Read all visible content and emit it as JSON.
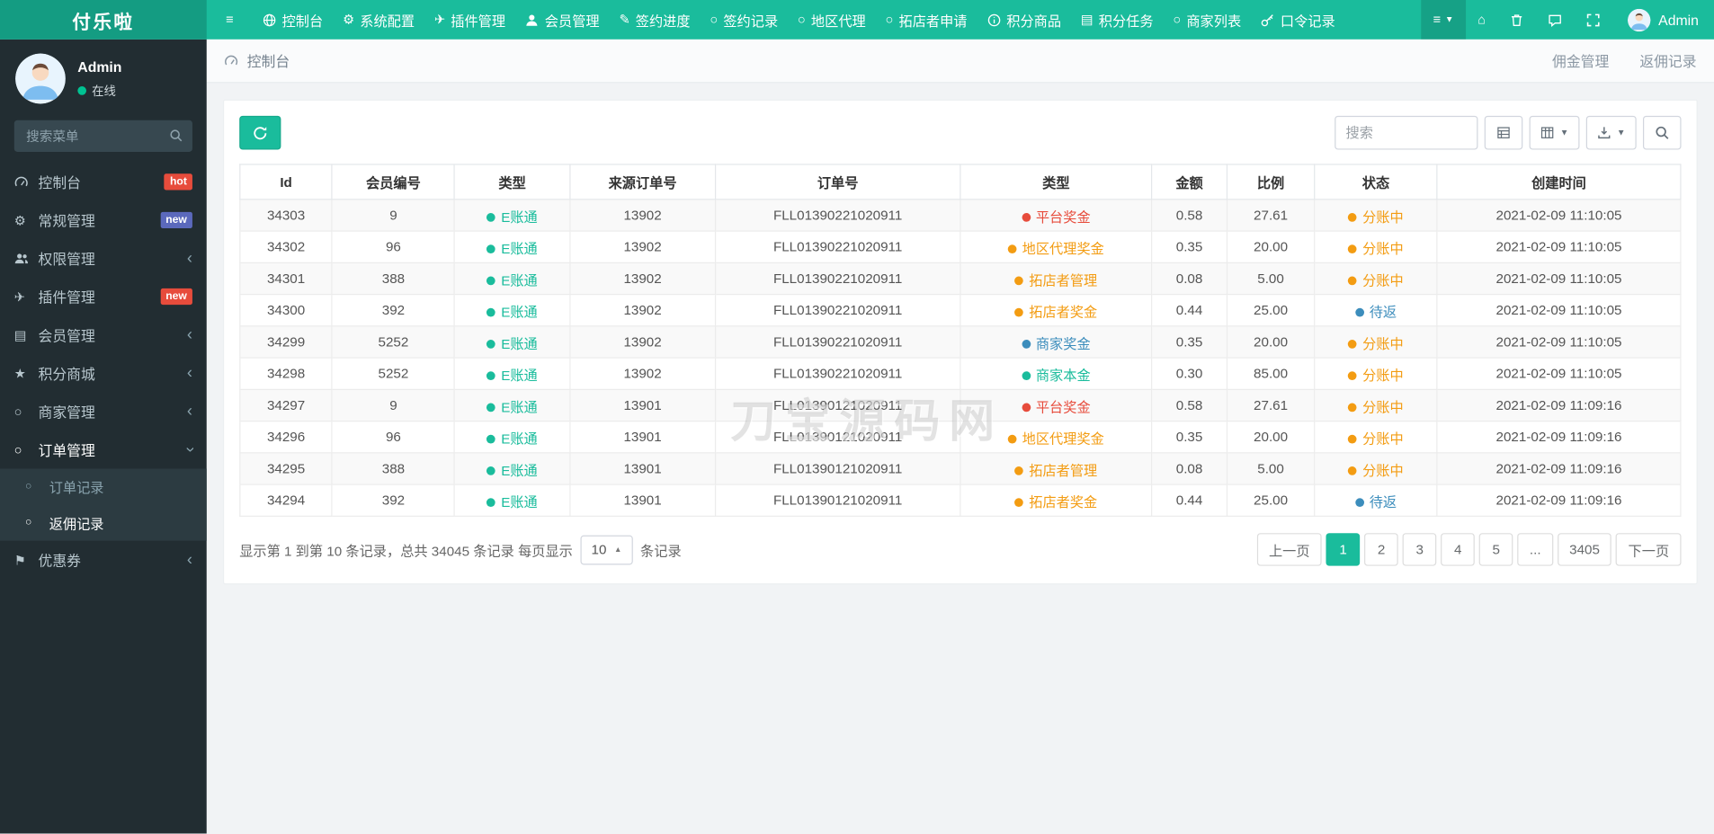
{
  "brand": "付乐啦",
  "colors": {
    "accent": "#1abc9c",
    "red": "#e74c3c",
    "orange": "#f39c12",
    "blue": "#3c8dbc",
    "green": "#1abc9c"
  },
  "topnav": {
    "username": "Admin",
    "items": [
      {
        "key": "console",
        "icon": "globe",
        "label": "控制台"
      },
      {
        "key": "system-config",
        "icon": "gear",
        "label": "系统配置"
      },
      {
        "key": "addon-manage",
        "icon": "plane",
        "label": "插件管理"
      },
      {
        "key": "member-manage",
        "icon": "user",
        "label": "会员管理"
      },
      {
        "key": "sign-progress",
        "icon": "pencil",
        "label": "签约进度"
      },
      {
        "key": "sign-records",
        "icon": "circle",
        "label": "签约记录"
      },
      {
        "key": "region-agent",
        "icon": "circle",
        "label": "地区代理"
      },
      {
        "key": "shop-applicant",
        "icon": "circle",
        "label": "拓店者申请"
      },
      {
        "key": "score-goods",
        "icon": "info",
        "label": "积分商品"
      },
      {
        "key": "score-tasks",
        "icon": "list",
        "label": "积分任务"
      },
      {
        "key": "merchant-list",
        "icon": "circle",
        "label": "商家列表"
      },
      {
        "key": "token-records",
        "icon": "key",
        "label": "口令记录"
      }
    ]
  },
  "sidebar": {
    "username": "Admin",
    "status": "在线",
    "search_placeholder": "搜索菜单",
    "items": [
      {
        "key": "dashboard",
        "icon": "gauge",
        "label": "控制台",
        "badge": "hot",
        "badge_color": "#e74c3c"
      },
      {
        "key": "general-manage",
        "icon": "gear",
        "label": "常规管理",
        "badge": "new",
        "badge_color": "#5b69bc"
      },
      {
        "key": "auth-manage",
        "icon": "users",
        "label": "权限管理",
        "chevron": "left"
      },
      {
        "key": "addon-manage",
        "icon": "plane",
        "label": "插件管理",
        "badge": "new",
        "badge_color": "#e74c3c"
      },
      {
        "key": "member-manage",
        "icon": "list",
        "label": "会员管理",
        "chevron": "left"
      },
      {
        "key": "score-mall",
        "icon": "star",
        "label": "积分商城",
        "chevron": "left"
      },
      {
        "key": "merchant-manage",
        "icon": "circle",
        "label": "商家管理",
        "chevron": "left"
      },
      {
        "key": "order-manage",
        "icon": "circle",
        "label": "订单管理",
        "chevron": "down",
        "open": true,
        "children": [
          {
            "key": "order-records",
            "icon": "circle",
            "label": "订单记录",
            "active": false
          },
          {
            "key": "commission-records",
            "icon": "circle",
            "label": "返佣记录",
            "active": true
          }
        ]
      },
      {
        "key": "coupon",
        "icon": "flag",
        "label": "优惠券",
        "chevron": "left"
      }
    ]
  },
  "breadcrumb": {
    "left": "控制台",
    "right": [
      "佣金管理",
      "返佣记录"
    ]
  },
  "toolbar": {
    "search_placeholder": "搜索"
  },
  "table": {
    "columns": [
      "Id",
      "会员编号",
      "类型",
      "来源订单号",
      "订单号",
      "类型",
      "金额",
      "比例",
      "状态",
      "创建时间"
    ],
    "rows": [
      {
        "id": "34303",
        "member": "9",
        "account_type": "E账通",
        "source_order": "13902",
        "order_no": "FLL01390221020911",
        "bonus_type": "平台奖金",
        "bonus_color": "red",
        "amount": "0.58",
        "ratio": "27.61",
        "status": "分账中",
        "status_color": "orange",
        "created_at": "2021-02-09 11:10:05"
      },
      {
        "id": "34302",
        "member": "96",
        "account_type": "E账通",
        "source_order": "13902",
        "order_no": "FLL01390221020911",
        "bonus_type": "地区代理奖金",
        "bonus_color": "orange",
        "amount": "0.35",
        "ratio": "20.00",
        "status": "分账中",
        "status_color": "orange",
        "created_at": "2021-02-09 11:10:05"
      },
      {
        "id": "34301",
        "member": "388",
        "account_type": "E账通",
        "source_order": "13902",
        "order_no": "FLL01390221020911",
        "bonus_type": "拓店者管理",
        "bonus_color": "orange",
        "amount": "0.08",
        "ratio": "5.00",
        "status": "分账中",
        "status_color": "orange",
        "created_at": "2021-02-09 11:10:05"
      },
      {
        "id": "34300",
        "member": "392",
        "account_type": "E账通",
        "source_order": "13902",
        "order_no": "FLL01390221020911",
        "bonus_type": "拓店者奖金",
        "bonus_color": "orange",
        "amount": "0.44",
        "ratio": "25.00",
        "status": "待返",
        "status_color": "blue",
        "created_at": "2021-02-09 11:10:05"
      },
      {
        "id": "34299",
        "member": "5252",
        "account_type": "E账通",
        "source_order": "13902",
        "order_no": "FLL01390221020911",
        "bonus_type": "商家奖金",
        "bonus_color": "blue",
        "amount": "0.35",
        "ratio": "20.00",
        "status": "分账中",
        "status_color": "orange",
        "created_at": "2021-02-09 11:10:05"
      },
      {
        "id": "34298",
        "member": "5252",
        "account_type": "E账通",
        "source_order": "13902",
        "order_no": "FLL01390221020911",
        "bonus_type": "商家本金",
        "bonus_color": "green",
        "amount": "0.30",
        "ratio": "85.00",
        "status": "分账中",
        "status_color": "orange",
        "created_at": "2021-02-09 11:10:05"
      },
      {
        "id": "34297",
        "member": "9",
        "account_type": "E账通",
        "source_order": "13901",
        "order_no": "FLL01390121020911",
        "bonus_type": "平台奖金",
        "bonus_color": "red",
        "amount": "0.58",
        "ratio": "27.61",
        "status": "分账中",
        "status_color": "orange",
        "created_at": "2021-02-09 11:09:16"
      },
      {
        "id": "34296",
        "member": "96",
        "account_type": "E账通",
        "source_order": "13901",
        "order_no": "FLL01390121020911",
        "bonus_type": "地区代理奖金",
        "bonus_color": "orange",
        "amount": "0.35",
        "ratio": "20.00",
        "status": "分账中",
        "status_color": "orange",
        "created_at": "2021-02-09 11:09:16"
      },
      {
        "id": "34295",
        "member": "388",
        "account_type": "E账通",
        "source_order": "13901",
        "order_no": "FLL01390121020911",
        "bonus_type": "拓店者管理",
        "bonus_color": "orange",
        "amount": "0.08",
        "ratio": "5.00",
        "status": "分账中",
        "status_color": "orange",
        "created_at": "2021-02-09 11:09:16"
      },
      {
        "id": "34294",
        "member": "392",
        "account_type": "E账通",
        "source_order": "13901",
        "order_no": "FLL01390121020911",
        "bonus_type": "拓店者奖金",
        "bonus_color": "orange",
        "amount": "0.44",
        "ratio": "25.00",
        "status": "待返",
        "status_color": "blue",
        "created_at": "2021-02-09 11:09:16"
      }
    ]
  },
  "footer": {
    "summary_prefix": "显示第 1 到第 10 条记录，总共 34045 条记录 每页显示",
    "page_size": "10",
    "summary_suffix": "条记录",
    "pagination": [
      {
        "key": "prev",
        "label": "上一页",
        "active": false
      },
      {
        "key": "1",
        "label": "1",
        "active": true
      },
      {
        "key": "2",
        "label": "2",
        "active": false
      },
      {
        "key": "3",
        "label": "3",
        "active": false
      },
      {
        "key": "4",
        "label": "4",
        "active": false
      },
      {
        "key": "5",
        "label": "5",
        "active": false
      },
      {
        "key": "ellipsis",
        "label": "...",
        "active": false
      },
      {
        "key": "3405",
        "label": "3405",
        "active": false
      },
      {
        "key": "next",
        "label": "下一页",
        "active": false
      }
    ]
  },
  "watermark": "刀宝源码网"
}
